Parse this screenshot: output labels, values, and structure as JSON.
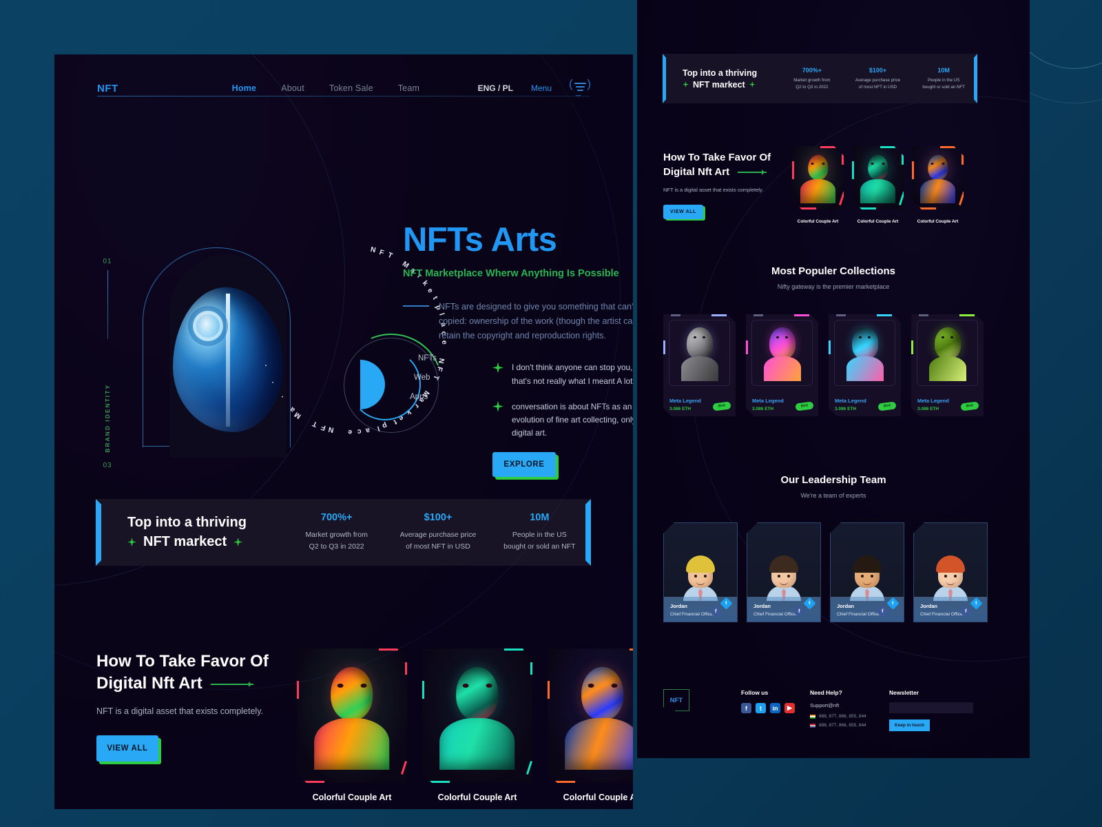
{
  "brand": {
    "logo": "NFT"
  },
  "nav": {
    "links": [
      {
        "label": "Home",
        "active": true
      },
      {
        "label": "About",
        "active": false
      },
      {
        "label": "Token Sale",
        "active": false
      },
      {
        "label": "Team",
        "active": false
      }
    ],
    "lang": "ENG / PL",
    "menu_label": "Menu",
    "menu_icon": "hamburger-icon"
  },
  "hero": {
    "marks": {
      "top": "01",
      "bottom": "03",
      "vertical": "BRAND IDENTITY"
    },
    "circular_text": "NFT Marketplace NFT Marketplace NFT Ma . . .",
    "dial_labels": [
      "NFTs",
      "Web",
      "Apps"
    ],
    "title": "NFTs Arts",
    "subtitle": "NFT Marketplace Wherw Anything Is Possible",
    "paragraph": "NFTs are designed to give you something that can't be copied: ownership of the work (though the artist can still retain the copyright and reproduction rights.",
    "bullets": [
      "I don't think anyone can stop you, but that's not really what I meant A lot of the.",
      "conversation is about NFTs as an evolution of fine art collecting, only with digital art."
    ],
    "cta": "EXPLORE"
  },
  "stats_banner": {
    "title_line1": "Top into a thriving",
    "title_line2": "NFT markect",
    "items": [
      {
        "value": "700%+",
        "desc_line1": "Market growth from",
        "desc_line2": "Q2 to Q3 in 2022"
      },
      {
        "value": "$100+",
        "desc_line1": "Average purchase price",
        "desc_line2": "of most NFT in USD"
      },
      {
        "value": "10M",
        "desc_line1": "People in the US",
        "desc_line2": "bought or sold an NFT"
      }
    ]
  },
  "favor": {
    "title_line1": "How To Take Favor Of",
    "title_line2": "Digital Nft Art",
    "subtitle": "NFT is a digital asset that exists completely.",
    "cta": "VIEW ALL",
    "cards": [
      {
        "caption": "Colorful Couple Art",
        "accent": "#ff3b5c"
      },
      {
        "caption": "Colorful Couple Art",
        "accent": "#19e0c0"
      },
      {
        "caption": "Colorful Couple Art",
        "accent": "#ff6a2b"
      }
    ]
  },
  "collections": {
    "title": "Most Populer Collections",
    "subtitle": "Nifty gateway is the premier marketplace",
    "cards": [
      {
        "name": "Meta Legend",
        "price": "3.086 ETH",
        "pill": "Bird",
        "accent": "#9bb0ff"
      },
      {
        "name": "Meta Legend",
        "price": "3.086 ETH",
        "pill": "Bird",
        "accent": "#ff4fd8"
      },
      {
        "name": "Meta Legend",
        "price": "3.086 ETH",
        "pill": "Bird",
        "accent": "#36d6ff"
      },
      {
        "name": "Meta Legend",
        "price": "3.086 ETH",
        "pill": "Bird",
        "accent": "#8ef03a"
      }
    ]
  },
  "team": {
    "title": "Our Leadership Team",
    "subtitle": "We're a team of experts",
    "members": [
      {
        "name": "Jordan",
        "role": "Chief Financial Officer",
        "hair": "#e0c23a",
        "skin": "#f3c49c"
      },
      {
        "name": "Jordan",
        "role": "Chief Financial Officer",
        "hair": "#3c2a1e",
        "skin": "#f2c7a3"
      },
      {
        "name": "Jordan",
        "role": "Chief Financial Officer",
        "hair": "#241a12",
        "skin": "#e5ac77"
      },
      {
        "name": "Jordan",
        "role": "Chief Financial Officer",
        "hair": "#d4542a",
        "skin": "#f6cfae"
      }
    ]
  },
  "footer": {
    "logo": "NFT",
    "follow_heading": "Follow us",
    "socials": [
      {
        "name": "facebook-icon",
        "glyph": "f",
        "color": "#3b5998"
      },
      {
        "name": "twitter-icon",
        "glyph": "t",
        "color": "#1da1f2"
      },
      {
        "name": "linkedin-icon",
        "glyph": "in",
        "color": "#0a66c2"
      },
      {
        "name": "youtube-icon",
        "glyph": "▶",
        "color": "#e02f2f"
      }
    ],
    "help_heading": "Need Help?",
    "support": "Support@nft",
    "phones": [
      "888, 877, 866, 855, 844",
      "888, 877, 866, 855, 844"
    ],
    "newsletter_heading": "Newsletter",
    "newsletter_placeholder": "",
    "newsletter_value": "",
    "newsletter_cta": "Keep in touch"
  },
  "colors": {
    "accent_blue": "#29a8f5",
    "accent_green": "#2ecc40",
    "panel_dark": "#0a0418",
    "page_bg": "#0a4165"
  }
}
